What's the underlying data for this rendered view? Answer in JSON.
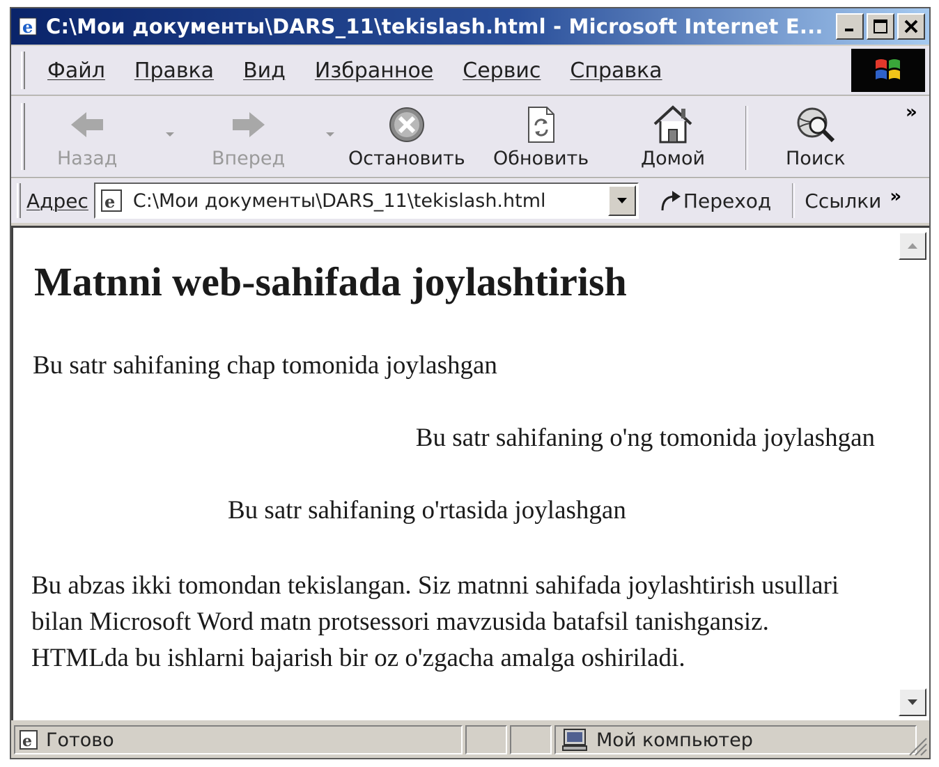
{
  "window": {
    "title": "C:\\Мои документы\\DARS_11\\tekislash.html - Microsoft Internet E..."
  },
  "menu": {
    "items": [
      {
        "label": "Файл"
      },
      {
        "label": "Правка"
      },
      {
        "label": "Вид"
      },
      {
        "label": "Избранное"
      },
      {
        "label": "Сервис"
      },
      {
        "label": "Справка"
      }
    ]
  },
  "toolbar": {
    "back_label": "Назад",
    "forward_label": "Вперед",
    "stop_label": "Остановить",
    "refresh_label": "Обновить",
    "home_label": "Домой",
    "search_label": "Поиск",
    "more_label": "»"
  },
  "address": {
    "label": "Адрес",
    "value": "C:\\Мои документы\\DARS_11\\tekislash.html",
    "go_label": "Переход",
    "links_label": "Ссылки",
    "links_more": "»"
  },
  "page": {
    "heading": "Matnni web-sahifada joylashtirish",
    "left_text": "Bu satr sahifaning chap tomonida joylashgan",
    "right_text": "Bu satr sahifaning o'ng tomonida joylashgan",
    "center_text": "Bu satr sahifaning o'rtasida joylashgan",
    "justify_text": "Bu abzas ikki tomondan tekislangan. Siz matnni sahifada joylashtirish usullari bilan Microsoft Word matn protsessori mavzusida batafsil tanishgansiz. HTMLda bu ishlarni bajarish bir oz o'zgacha amalga oshiriladi."
  },
  "status": {
    "text": "Готово",
    "zone": "Мой компьютер"
  },
  "colors": {
    "titlebar_start": "#0a246a",
    "titlebar_end": "#a6caf0",
    "chrome": "#d4d0c8"
  }
}
